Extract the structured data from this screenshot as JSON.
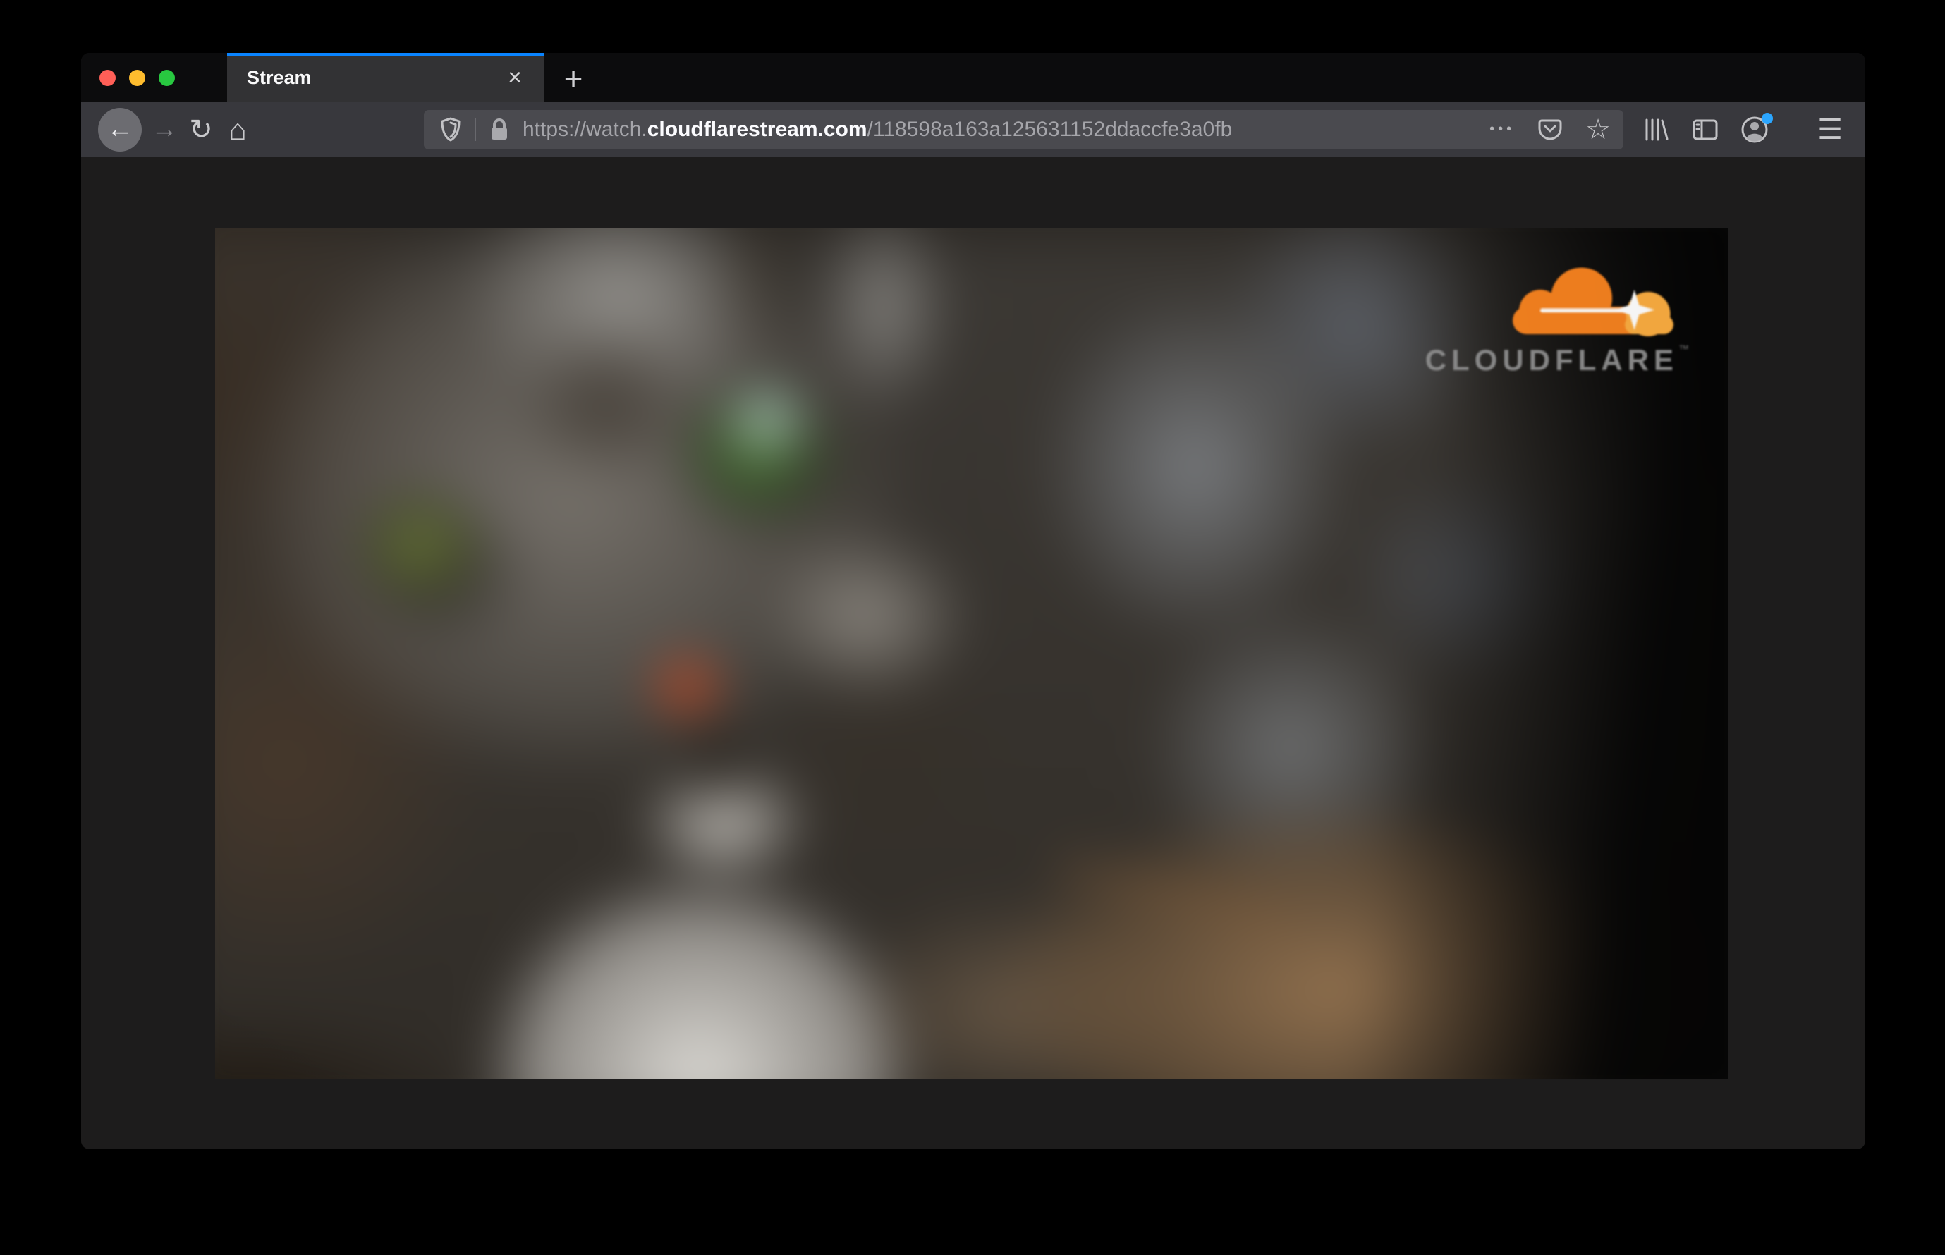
{
  "colors": {
    "accent_blue": "#0a84ff",
    "traffic_red": "#ff5f57",
    "traffic_yellow": "#febc2e",
    "traffic_green": "#28c840",
    "toolbar_bg": "#38383d",
    "urlbar_bg": "#4a4a4f",
    "tabstrip_bg": "#0c0c0d",
    "active_tab_bg": "#323234",
    "content_bg": "#1d1c1c",
    "cloudflare_orange": "#f6821f",
    "cloudflare_orange_light": "#fbad41",
    "notification_dot": "#2ba6ff",
    "cloudflare_wordmark_gray": "#8b8b8b"
  },
  "tab_bar": {
    "active_tab": {
      "label": "Stream",
      "close_glyph": "×"
    },
    "new_tab_glyph": "+"
  },
  "toolbar": {
    "back_glyph": "←",
    "forward_glyph": "→",
    "reload_glyph": "↻",
    "home_glyph": "⌂",
    "page_actions_glyph": "•••",
    "bookmark_glyph": "☆",
    "menu_glyph": "☰",
    "icons": [
      "tracking-protection-shield-icon",
      "lock-icon",
      "page-actions-icon",
      "pocket-icon",
      "bookmark-star-icon",
      "library-icon",
      "sidebar-icon",
      "account-icon",
      "menu-icon"
    ],
    "url": {
      "scheme_and_sub": "https://watch.",
      "domain": "cloudflarestream.com",
      "path": "/118598a163a125631152ddaccfe3a0fb"
    }
  },
  "video": {
    "watermark_brand": "CLOUDFLARE",
    "watermark_trademark": "™",
    "description": "blurred close-up of a gray tabby cat with green eyes"
  }
}
